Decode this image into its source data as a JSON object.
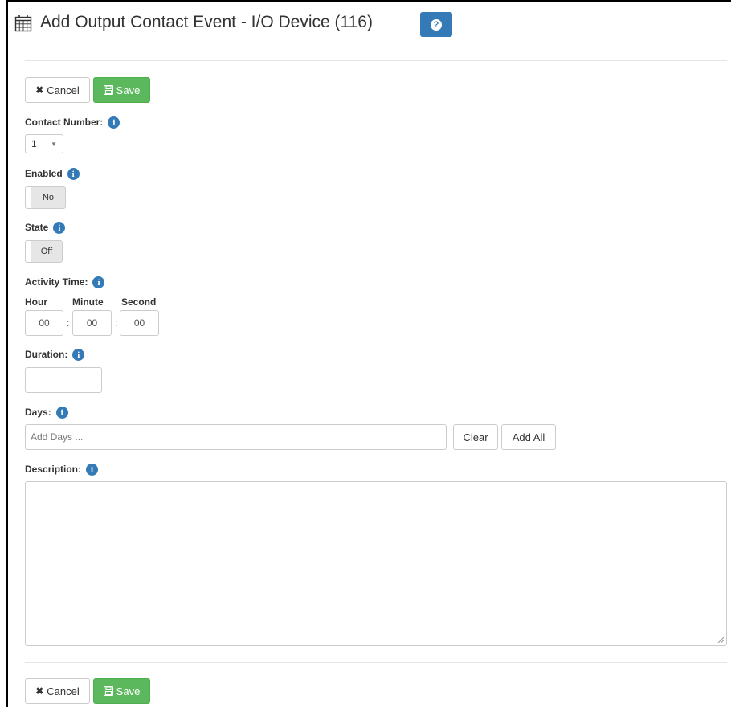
{
  "header": {
    "title": "Add Output Contact Event - I/O Device (116)",
    "calendar_icon": "calendar-icon",
    "help_icon": "question-circle-icon"
  },
  "toolbar_top": {
    "cancel_label": "Cancel",
    "save_label": "Save"
  },
  "toolbar_bottom": {
    "cancel_label": "Cancel",
    "save_label": "Save"
  },
  "form": {
    "contact_number": {
      "label": "Contact Number:",
      "value": "1"
    },
    "enabled": {
      "label": "Enabled",
      "value": "No"
    },
    "state": {
      "label": "State",
      "value": "Off"
    },
    "activity_time": {
      "label": "Activity Time:",
      "hour_label": "Hour",
      "minute_label": "Minute",
      "second_label": "Second",
      "hour": "00",
      "minute": "00",
      "second": "00",
      "separator": ":"
    },
    "duration": {
      "label": "Duration:",
      "value": ""
    },
    "days": {
      "label": "Days:",
      "placeholder": "Add Days ...",
      "clear_label": "Clear",
      "add_all_label": "Add All"
    },
    "description": {
      "label": "Description:",
      "value": ""
    }
  },
  "colors": {
    "primary": "#337ab7",
    "success": "#5cb85c"
  }
}
